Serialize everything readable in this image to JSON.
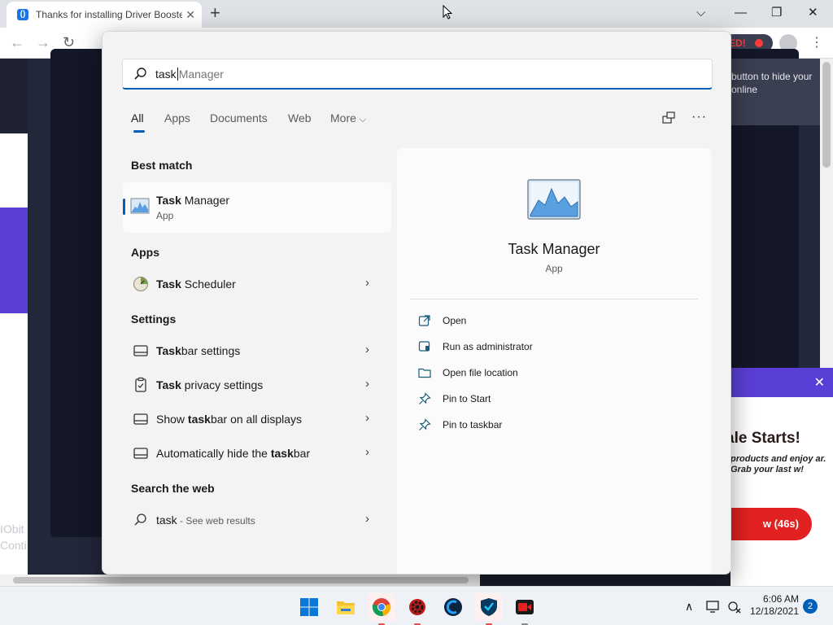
{
  "browser": {
    "tab_title": "Thanks for installing Driver Booster",
    "tab_close": "✕",
    "new_tab": "+",
    "minimize": "—",
    "restore": "❐",
    "close": "✕",
    "back": "←",
    "forward": "→",
    "reload": "↻",
    "rec_label": "ED!",
    "menu": "⋮"
  },
  "background_page": {
    "tooltip": "button to hide your online",
    "iobit_line1": "IObit",
    "iobit_line2": "Conti",
    "ad_close": "✕",
    "ad_title": "ale Starts!",
    "ad_body": "products and enjoy ar. Grab your last w!",
    "ad_button": "w (46s)"
  },
  "search": {
    "typed": "task",
    "suggestion": "Manager",
    "filters": [
      "All",
      "Apps",
      "Documents",
      "Web",
      "More"
    ],
    "more_chevron": "⌵",
    "more_options": "···",
    "best_match_heading": "Best match",
    "best_match": {
      "bold": "Task",
      "rest": " Manager",
      "kind": "App"
    },
    "apps_heading": "Apps",
    "apps": [
      {
        "bold": "Task",
        "rest": " Scheduler"
      }
    ],
    "settings_heading": "Settings",
    "settings": [
      {
        "pre": "",
        "bold": "Task",
        "rest": "bar settings"
      },
      {
        "pre": "",
        "bold": "Task",
        "rest": " privacy settings"
      },
      {
        "pre": "Show ",
        "bold": "task",
        "rest": "bar on all displays"
      },
      {
        "pre": "Automatically hide the ",
        "bold": "task",
        "rest": "bar"
      }
    ],
    "web_heading": "Search the web",
    "web": {
      "query": "task",
      "sub": " - See web results"
    },
    "chevron": "›"
  },
  "detail": {
    "name": "Task Manager",
    "kind": "App",
    "actions": [
      "Open",
      "Run as administrator",
      "Open file location",
      "Pin to Start",
      "Pin to taskbar"
    ]
  },
  "taskbar": {
    "time": "6:06 AM",
    "date": "12/18/2021",
    "notifications": "2",
    "tray_up": "∧"
  },
  "colors": {
    "accent": "#005fb8",
    "flyout_bg": "#f3f3f3",
    "ad_red": "#e22222",
    "purple": "#5b3fd6"
  }
}
